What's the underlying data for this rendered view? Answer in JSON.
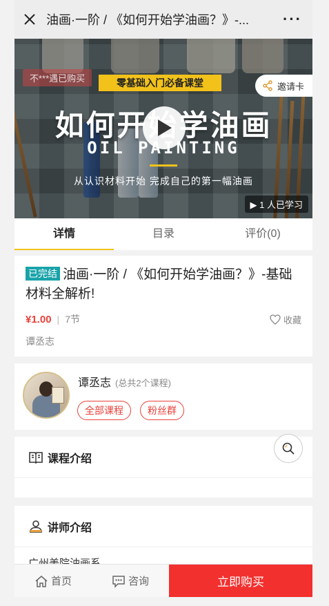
{
  "topbar": {
    "title": "油画·一阶 / 《如何开始学油画？》-...",
    "more": "···"
  },
  "banner": {
    "buyer_tag": "不***遇已购买",
    "course_tag": "零基础入门必备课堂",
    "invite_label": "邀请卡",
    "big_title": "如何开始学油画",
    "sub_en": "OIL PAINTING",
    "sub_cn": "从认识材料开始  完成自己的第一幅油画",
    "learned": "1 人已学习",
    "accent_color": "#f2c21b"
  },
  "tabs": [
    {
      "label": "详情",
      "active": true
    },
    {
      "label": "目录",
      "active": false
    },
    {
      "label": "评价(0)",
      "active": false
    }
  ],
  "course": {
    "status_badge": "已完结",
    "title": "油画·一阶 / 《如何开始学油画？》-基础材料全解析!",
    "price": "¥1.00",
    "sep": "|",
    "lessons": "7节",
    "favorite_label": "收藏",
    "author": "谭丞志"
  },
  "teacher": {
    "name": "谭丞志",
    "count": "(总共2个课程)",
    "all_courses": "全部课程",
    "fans_group": "粉丝群"
  },
  "sections": {
    "intro_title": "课程介绍",
    "teacher_intro_title": "讲师介绍",
    "teacher_intro_text": "广州美院油画系"
  },
  "bottom": {
    "home": "首页",
    "consult": "咨询",
    "buy": "立即购买",
    "buy_color": "#f2302e"
  }
}
